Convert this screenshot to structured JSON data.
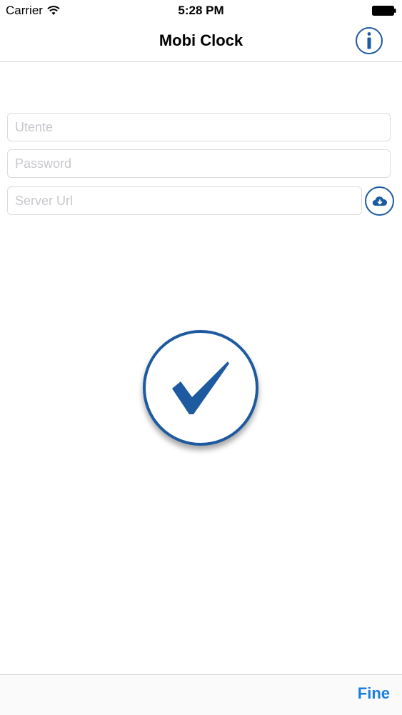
{
  "status_bar": {
    "carrier": "Carrier",
    "time": "5:28 PM",
    "icons": [
      "wifi-icon",
      "battery-icon"
    ]
  },
  "nav": {
    "title": "Mobi Clock",
    "info_icon": "info-icon"
  },
  "form": {
    "user": {
      "value": "",
      "placeholder": "Utente"
    },
    "password": {
      "value": "",
      "placeholder": "Password"
    },
    "server_url": {
      "value": "",
      "placeholder": "Server Url"
    },
    "cloud_icon": "cloud-download-icon"
  },
  "confirm": {
    "icon": "checkmark-icon"
  },
  "toolbar": {
    "done_label": "Fine"
  },
  "colors": {
    "accent": "#1d5aa0",
    "link": "#1a7de0",
    "placeholder": "#c7c7cd",
    "border": "#dcdcdc"
  }
}
